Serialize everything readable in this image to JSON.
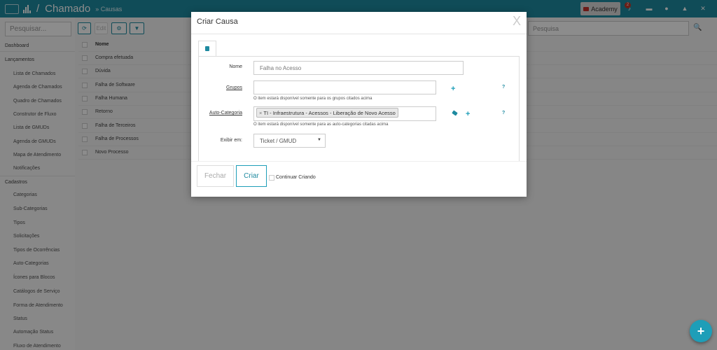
{
  "topbar": {
    "separator": "/",
    "app_title": "Chamado",
    "breadcrumb": "» Causas",
    "academy_label": "Academy",
    "notification_count": "2"
  },
  "sidebar": {
    "search_placeholder": "Pesquisar...",
    "items": [
      {
        "label": "Dashboard",
        "kind": "head"
      },
      {
        "label": "Lançamentos",
        "kind": "head"
      },
      {
        "label": "Lista de Chamados",
        "kind": "sub"
      },
      {
        "label": "Agenda de Chamados",
        "kind": "sub"
      },
      {
        "label": "Quadro de Chamados",
        "kind": "sub"
      },
      {
        "label": "Construtor de Fluxo",
        "kind": "sub"
      },
      {
        "label": "Lista de GMUDs",
        "kind": "sub"
      },
      {
        "label": "Agenda de GMUDs",
        "kind": "sub"
      },
      {
        "label": "Mapa de Atendimento",
        "kind": "sub"
      },
      {
        "label": "Notificações",
        "kind": "sub"
      },
      {
        "label": "Cadastros",
        "kind": "head"
      },
      {
        "label": "Categorias",
        "kind": "sub"
      },
      {
        "label": "Sub-Categorias",
        "kind": "sub"
      },
      {
        "label": "Tipos",
        "kind": "sub"
      },
      {
        "label": "Solicitações",
        "kind": "sub"
      },
      {
        "label": "Tipos de Ocorrências",
        "kind": "sub"
      },
      {
        "label": "Auto-Categorias",
        "kind": "sub"
      },
      {
        "label": "Ícones para Blocos",
        "kind": "sub"
      },
      {
        "label": "Catálogos de Serviço",
        "kind": "sub"
      },
      {
        "label": "Forma de Atendimento",
        "kind": "sub"
      },
      {
        "label": "Status",
        "kind": "sub"
      },
      {
        "label": "Automação Status",
        "kind": "sub"
      },
      {
        "label": "Fluxo de Atendimento",
        "kind": "sub"
      }
    ]
  },
  "main": {
    "edit_label": "Edit",
    "search_placeholder": "Pesquisa",
    "list_header": "Nome",
    "rows": [
      "Compra efetuada",
      "Dúvida",
      "Falha de Software",
      "Falha Humana",
      "Retorno",
      "Falha de Terceiros",
      "Falha de Processos",
      "Novo Processo"
    ]
  },
  "modal": {
    "title": "Criar Causa",
    "close_glyph": "X",
    "fields": {
      "nome_label": "Nome",
      "nome_placeholder": "Falha no Acesso",
      "grupos_label": "Grupos",
      "grupos_help": "O item estará disponível somente para os grupos citados acima",
      "autocat_label": "Auto-Categoria",
      "autocat_tag_remove": "×",
      "autocat_tag": "TI - Infraestrutura - Acessos - Liberação de Novo Acesso",
      "autocat_help": "O item estará disponível somente para as auto-categorias citadas acima",
      "exibir_label": "Exibir em:",
      "exibir_value": "Ticket / GMUD",
      "help_glyph": "?",
      "plus_glyph": "+"
    },
    "buttons": {
      "fechar": "Fechar",
      "criar": "Criar",
      "continuar": "Continuar Criando"
    }
  },
  "fab_glyph": "+"
}
